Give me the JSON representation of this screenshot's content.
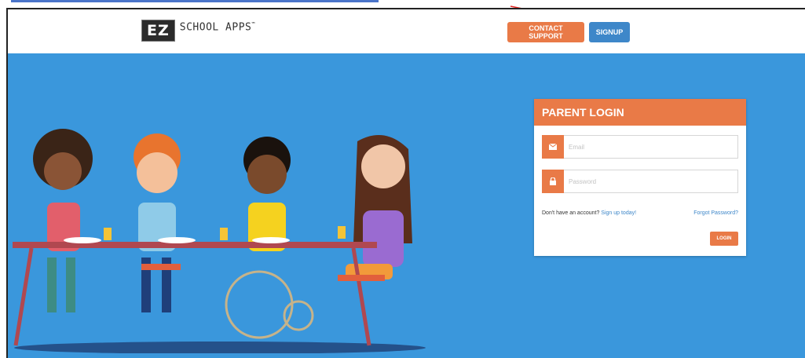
{
  "header": {
    "logo_mark": "EZ",
    "logo_text": "SCHOOL APPS",
    "logo_tm": "™",
    "contact_support_label": "CONTACT SUPPORT",
    "signup_label": "SIGNUP"
  },
  "login": {
    "title": "PARENT LOGIN",
    "email_placeholder": "Email",
    "password_placeholder": "Password",
    "no_account_text": "Don't have an account?",
    "signup_link_label": "Sign up today!",
    "forgot_password_label": "Forgot Password?",
    "login_button_label": "LOGIN"
  },
  "icons": {
    "email": "envelope-icon",
    "password": "lock-icon"
  },
  "colors": {
    "accent_orange": "#e97a47",
    "signup_blue": "#3e87c9",
    "hero_blue": "#3a97dc",
    "annotation_red": "#e0231f"
  }
}
